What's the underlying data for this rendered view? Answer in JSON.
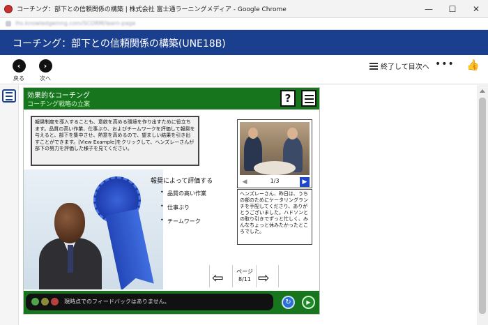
{
  "window": {
    "title": "コーチング：部下との信頼関係の構築 | 株式会社 富士通ラーニングメディア - Google Chrome",
    "minimize": "—",
    "maximize": "☐",
    "close": "✕"
  },
  "course": {
    "title": "コーチング：部下との信頼関係の構築(UNE18B)"
  },
  "toolbar": {
    "back_label": "戻る",
    "next_label": "次へ",
    "exit_label": "終了して目次へ",
    "more_icon": "•••",
    "like_icon": "👍"
  },
  "module": {
    "title": "効果的なコーチング",
    "subtitle": "コーチング戦略の立案",
    "help_label": "?",
    "intro_text": "報奨制度を導入することも、意欲を高める環境を作り出すために役立ちます。品質の高い作業、仕事ぶり、およびチームワークを評価して報奨を与えると、部下を集中させ、熱意を高めるので、望ましい結果を引き出すことができます。[View Example]をクリックして、ヘンズレーさんが部下の努力を評価した様子を見てください。",
    "reward_title": "報奨によって評価する",
    "bullets": [
      "品質の高い作業",
      "仕事ぶり",
      "チームワーク"
    ],
    "video_counter": "1/3",
    "dialog_text": "ヘンズレーさん、昨日は、うちの部のためにケータリングランチを手配してくださり、ありがとうございました。ハドソンとの取り引きでずっと忙しく、みんなちょっと休みたかったところでした。",
    "page_label": "ページ",
    "page_number": "8/11",
    "feedback_text": "現時点でのフィードバックはありません。"
  },
  "colors": {
    "course_header": "#1b3f8f",
    "module_green": "#17761d",
    "dot_green": "#4fa34a",
    "dot_olive": "#8a8a3a",
    "dot_red": "#b84040"
  }
}
